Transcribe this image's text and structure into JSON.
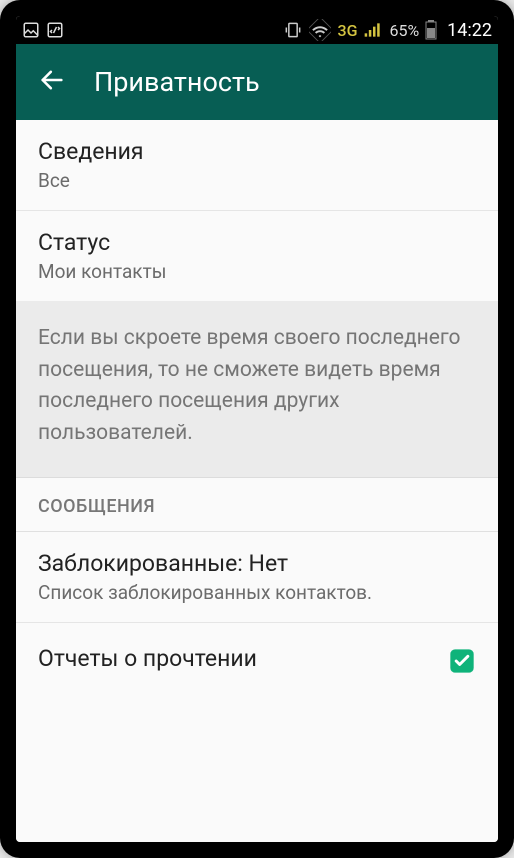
{
  "statusbar": {
    "network": "3G",
    "battery": "65%",
    "time": "14:22"
  },
  "appbar": {
    "title": "Приватность"
  },
  "items": {
    "about": {
      "title": "Сведения",
      "value": "Все"
    },
    "status": {
      "title": "Статус",
      "value": "Мои контакты"
    }
  },
  "info": {
    "text": "Если вы скроете время своего последнего посещения, то не сможете видеть время последнего посещения других пользователей."
  },
  "section": {
    "messages": "СООБЩЕНИЯ"
  },
  "blocked": {
    "title": "Заблокированные: Нет",
    "subtitle": "Список заблокированных контактов."
  },
  "readreceipts": {
    "title": "Отчеты о прочтении",
    "checked": true
  },
  "colors": {
    "accent": "#075e54",
    "check": "#0fb37a"
  }
}
